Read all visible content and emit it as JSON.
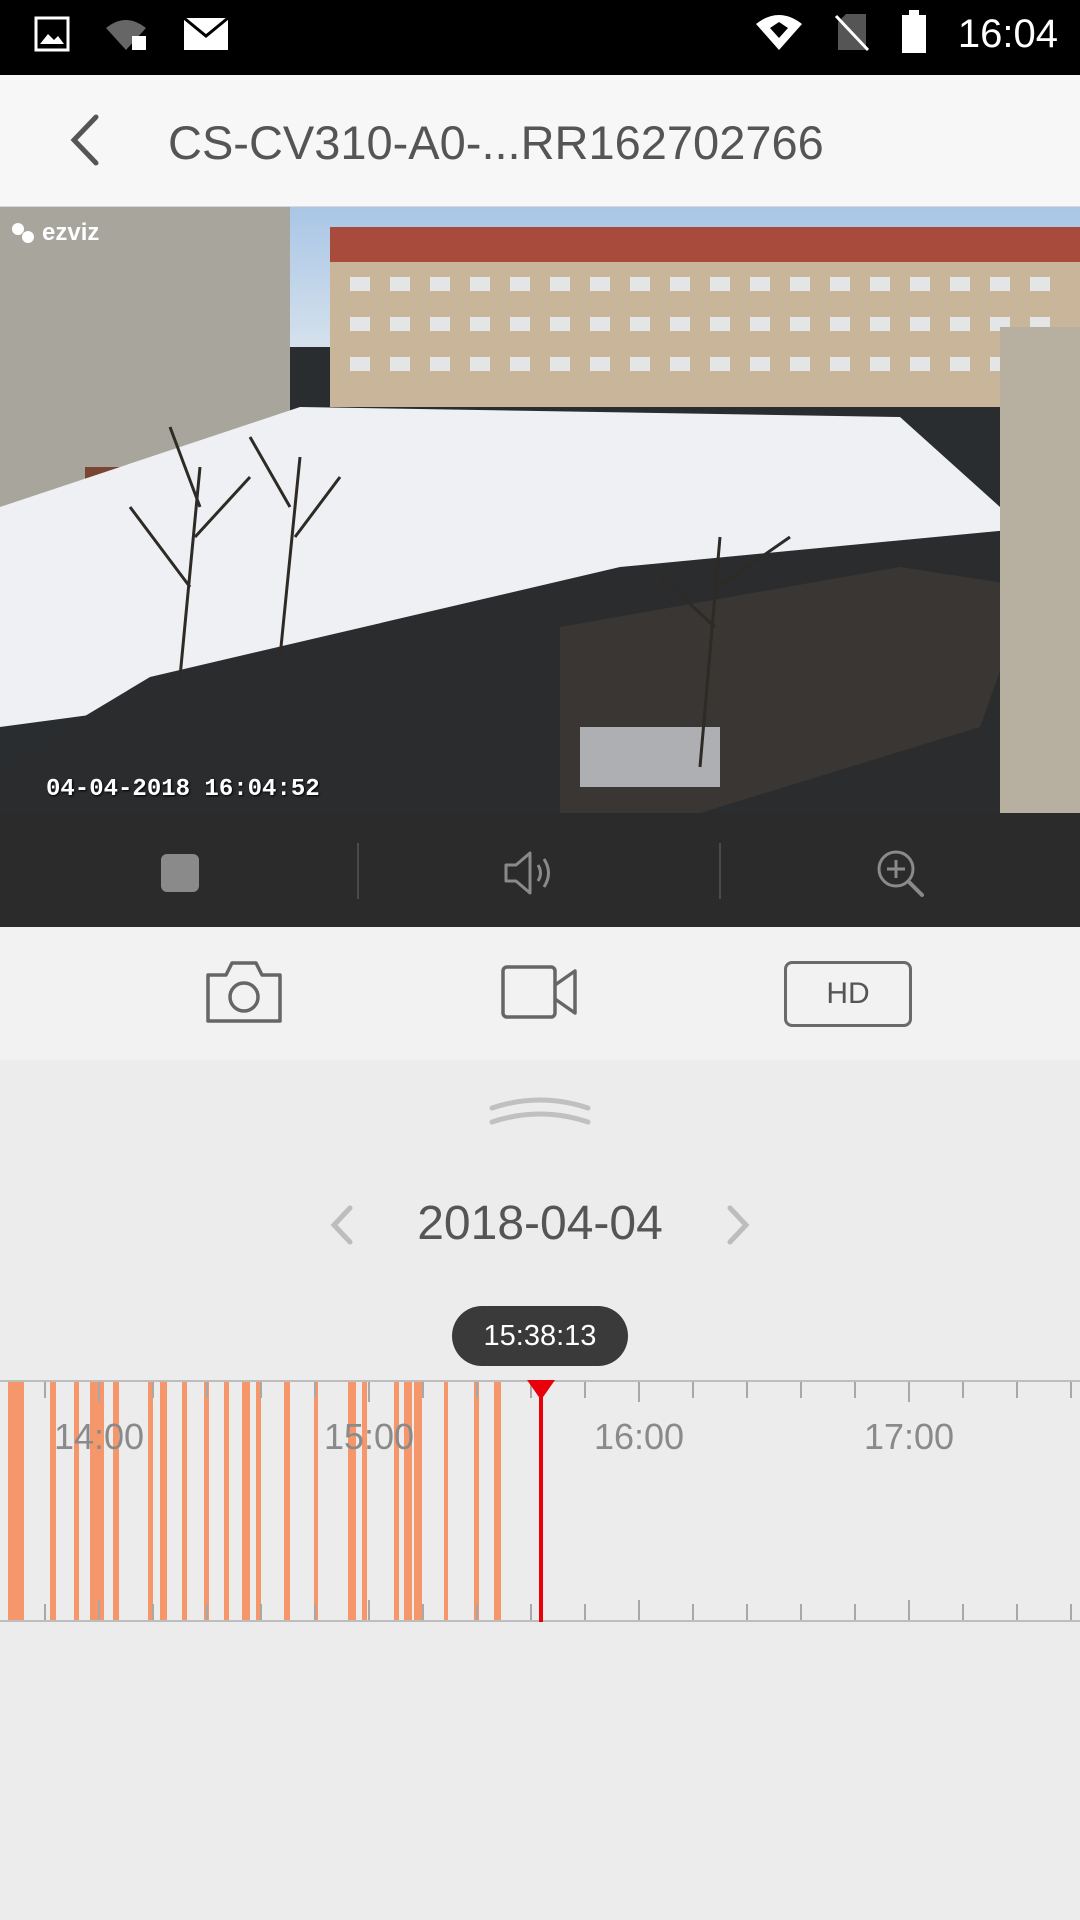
{
  "status_bar": {
    "time": "16:04",
    "left_icons": [
      "image-icon",
      "wifi-sync-icon",
      "mail-icon"
    ],
    "right_icons": [
      "wifi-icon",
      "no-sim-icon",
      "battery-icon"
    ]
  },
  "app_bar": {
    "back_icon": "chevron-left-icon",
    "title": "CS-CV310-A0-...RR162702766"
  },
  "video": {
    "brand": "ezviz",
    "timestamp": "04-04-2018 16:04:52"
  },
  "player_controls": {
    "items": [
      "stop-icon",
      "speaker-icon",
      "zoom-in-icon"
    ]
  },
  "tools": {
    "snapshot_icon": "camera-icon",
    "record_icon": "video-camera-icon",
    "quality_label": "HD"
  },
  "date_nav": {
    "date": "2018-04-04",
    "prev_icon": "chevron-left-icon",
    "next_icon": "chevron-right-icon"
  },
  "timeline": {
    "current_time": "15:38:13",
    "hour_labels": [
      "14:00",
      "15:00",
      "16:00",
      "17:00"
    ],
    "recording_color": "#f5976a",
    "cursor_color": "#e8000a"
  }
}
